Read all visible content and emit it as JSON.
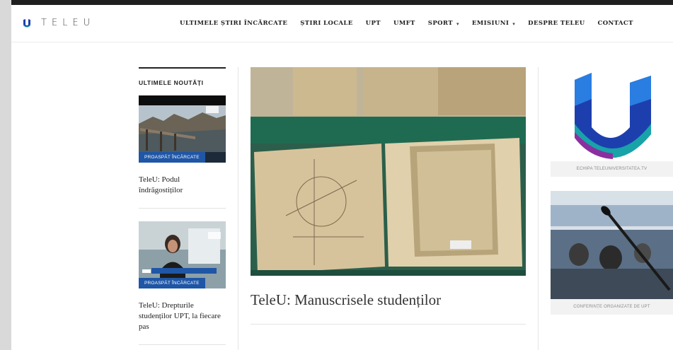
{
  "header": {
    "logo_text": "TELEU",
    "nav": [
      {
        "label": "ULTIMELE ȘTIRI ÎNCĂRCATE",
        "has_dropdown": false
      },
      {
        "label": "ȘTIRI LOCALE",
        "has_dropdown": false
      },
      {
        "label": "UPT",
        "has_dropdown": false
      },
      {
        "label": "UMFT",
        "has_dropdown": false
      },
      {
        "label": "SPORT",
        "has_dropdown": true
      },
      {
        "label": "EMISIUNI",
        "has_dropdown": true
      },
      {
        "label": "DESPRE TELEU",
        "has_dropdown": false
      },
      {
        "label": "CONTACT",
        "has_dropdown": false
      }
    ],
    "dropdown_glyph": "▾"
  },
  "left": {
    "section_title": "ULTIMELE NOUTĂȚI",
    "posts": [
      {
        "badge": "PROASPĂT ÎNCĂRCATE",
        "title": "TeleU: Podul îndrăgostiților"
      },
      {
        "badge": "PROASPĂT ÎNCĂRCATE",
        "title": "TeleU: Drepturile studenților UPT, la fiecare pas"
      }
    ]
  },
  "main": {
    "title": "TeleU: Manuscrisele studenților"
  },
  "right": {
    "card1_caption": "ECHIPA TELEUNIVERSITATEA.TV",
    "card2_caption": "CONFERINȚE ORGANIZATE DE UPT"
  },
  "colors": {
    "brand_blue": "#1f56a6",
    "logo_teal": "#18a3a8",
    "logo_blue": "#1d3fae"
  }
}
